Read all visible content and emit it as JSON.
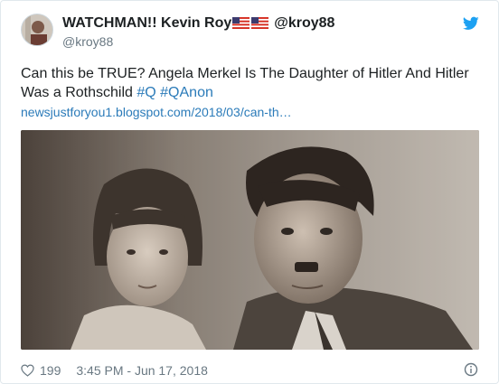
{
  "tweet": {
    "display_name": "WATCHMAN!! Kevin Roy",
    "name_handle": "@kroy88",
    "handle": "@kroy88",
    "text": "Can this be TRUE? Angela Merkel Is The Daughter of Hitler And Hitler Was a Rothschild",
    "hashtags": [
      "#Q",
      "#QAnon"
    ],
    "link_text": "newsjustforyou1.blogspot.com/2018/03/can-th…",
    "like_count": "199",
    "timestamp": "3:45 PM - Jun 17, 2018"
  },
  "icons": {
    "brand": "twitter-bird-icon",
    "flag": "us-flag-icon",
    "like": "heart-icon",
    "info": "info-icon"
  },
  "colors": {
    "link": "#2b7bb9",
    "brand": "#1da1f2",
    "muted": "#697882",
    "text": "#1c2022"
  }
}
